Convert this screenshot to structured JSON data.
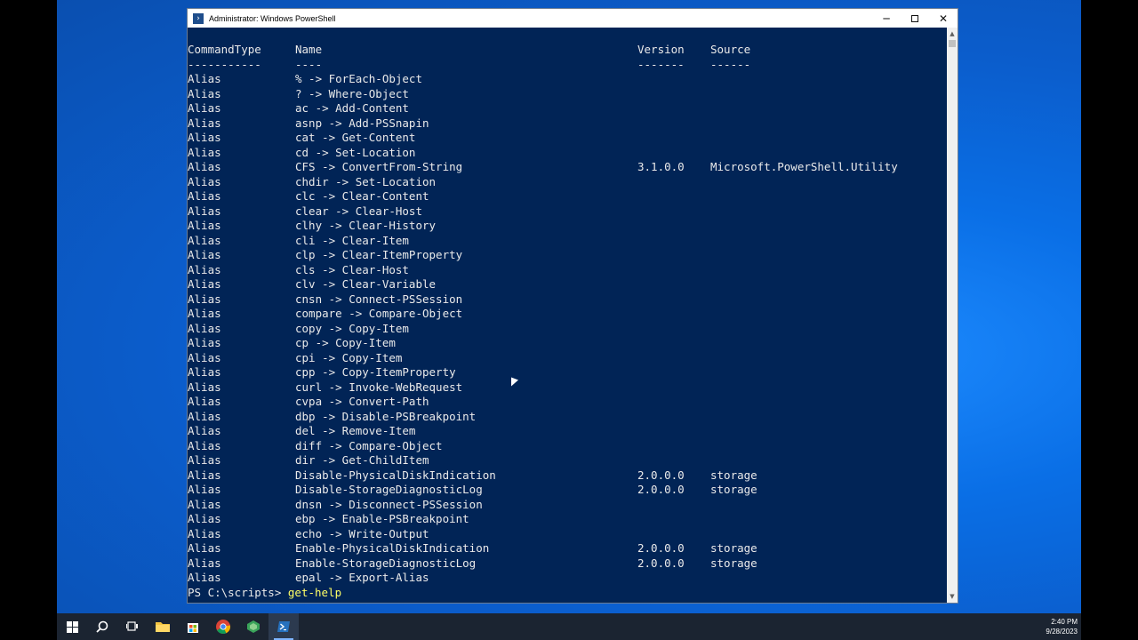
{
  "window": {
    "title": "Administrator: Windows PowerShell",
    "minimize_glyph": "─",
    "close_glyph": "✕"
  },
  "console": {
    "headers": [
      "CommandType",
      "Name",
      "Version",
      "Source"
    ],
    "separators": [
      "-----------",
      "----",
      "-------",
      "------"
    ],
    "rows": [
      [
        "Alias",
        "% -> ForEach-Object",
        "",
        ""
      ],
      [
        "Alias",
        "? -> Where-Object",
        "",
        ""
      ],
      [
        "Alias",
        "ac -> Add-Content",
        "",
        ""
      ],
      [
        "Alias",
        "asnp -> Add-PSSnapin",
        "",
        ""
      ],
      [
        "Alias",
        "cat -> Get-Content",
        "",
        ""
      ],
      [
        "Alias",
        "cd -> Set-Location",
        "",
        ""
      ],
      [
        "Alias",
        "CFS -> ConvertFrom-String",
        "3.1.0.0",
        "Microsoft.PowerShell.Utility"
      ],
      [
        "Alias",
        "chdir -> Set-Location",
        "",
        ""
      ],
      [
        "Alias",
        "clc -> Clear-Content",
        "",
        ""
      ],
      [
        "Alias",
        "clear -> Clear-Host",
        "",
        ""
      ],
      [
        "Alias",
        "clhy -> Clear-History",
        "",
        ""
      ],
      [
        "Alias",
        "cli -> Clear-Item",
        "",
        ""
      ],
      [
        "Alias",
        "clp -> Clear-ItemProperty",
        "",
        ""
      ],
      [
        "Alias",
        "cls -> Clear-Host",
        "",
        ""
      ],
      [
        "Alias",
        "clv -> Clear-Variable",
        "",
        ""
      ],
      [
        "Alias",
        "cnsn -> Connect-PSSession",
        "",
        ""
      ],
      [
        "Alias",
        "compare -> Compare-Object",
        "",
        ""
      ],
      [
        "Alias",
        "copy -> Copy-Item",
        "",
        ""
      ],
      [
        "Alias",
        "cp -> Copy-Item",
        "",
        ""
      ],
      [
        "Alias",
        "cpi -> Copy-Item",
        "",
        ""
      ],
      [
        "Alias",
        "cpp -> Copy-ItemProperty",
        "",
        ""
      ],
      [
        "Alias",
        "curl -> Invoke-WebRequest",
        "",
        ""
      ],
      [
        "Alias",
        "cvpa -> Convert-Path",
        "",
        ""
      ],
      [
        "Alias",
        "dbp -> Disable-PSBreakpoint",
        "",
        ""
      ],
      [
        "Alias",
        "del -> Remove-Item",
        "",
        ""
      ],
      [
        "Alias",
        "diff -> Compare-Object",
        "",
        ""
      ],
      [
        "Alias",
        "dir -> Get-ChildItem",
        "",
        ""
      ],
      [
        "Alias",
        "Disable-PhysicalDiskIndication",
        "2.0.0.0",
        "storage"
      ],
      [
        "Alias",
        "Disable-StorageDiagnosticLog",
        "2.0.0.0",
        "storage"
      ],
      [
        "Alias",
        "dnsn -> Disconnect-PSSession",
        "",
        ""
      ],
      [
        "Alias",
        "ebp -> Enable-PSBreakpoint",
        "",
        ""
      ],
      [
        "Alias",
        "echo -> Write-Output",
        "",
        ""
      ],
      [
        "Alias",
        "Enable-PhysicalDiskIndication",
        "2.0.0.0",
        "storage"
      ],
      [
        "Alias",
        "Enable-StorageDiagnosticLog",
        "2.0.0.0",
        "storage"
      ],
      [
        "Alias",
        "epal -> Export-Alias",
        "",
        ""
      ]
    ],
    "prompt": "PS C:\\scripts> ",
    "command": "get-help"
  },
  "taskbar": {
    "items": [
      "windows-start",
      "search",
      "task-view",
      "file-explorer",
      "microsoft-store",
      "chrome",
      "server-manager",
      "powershell"
    ],
    "time": "2:40 PM",
    "date": "9/28/2023"
  }
}
